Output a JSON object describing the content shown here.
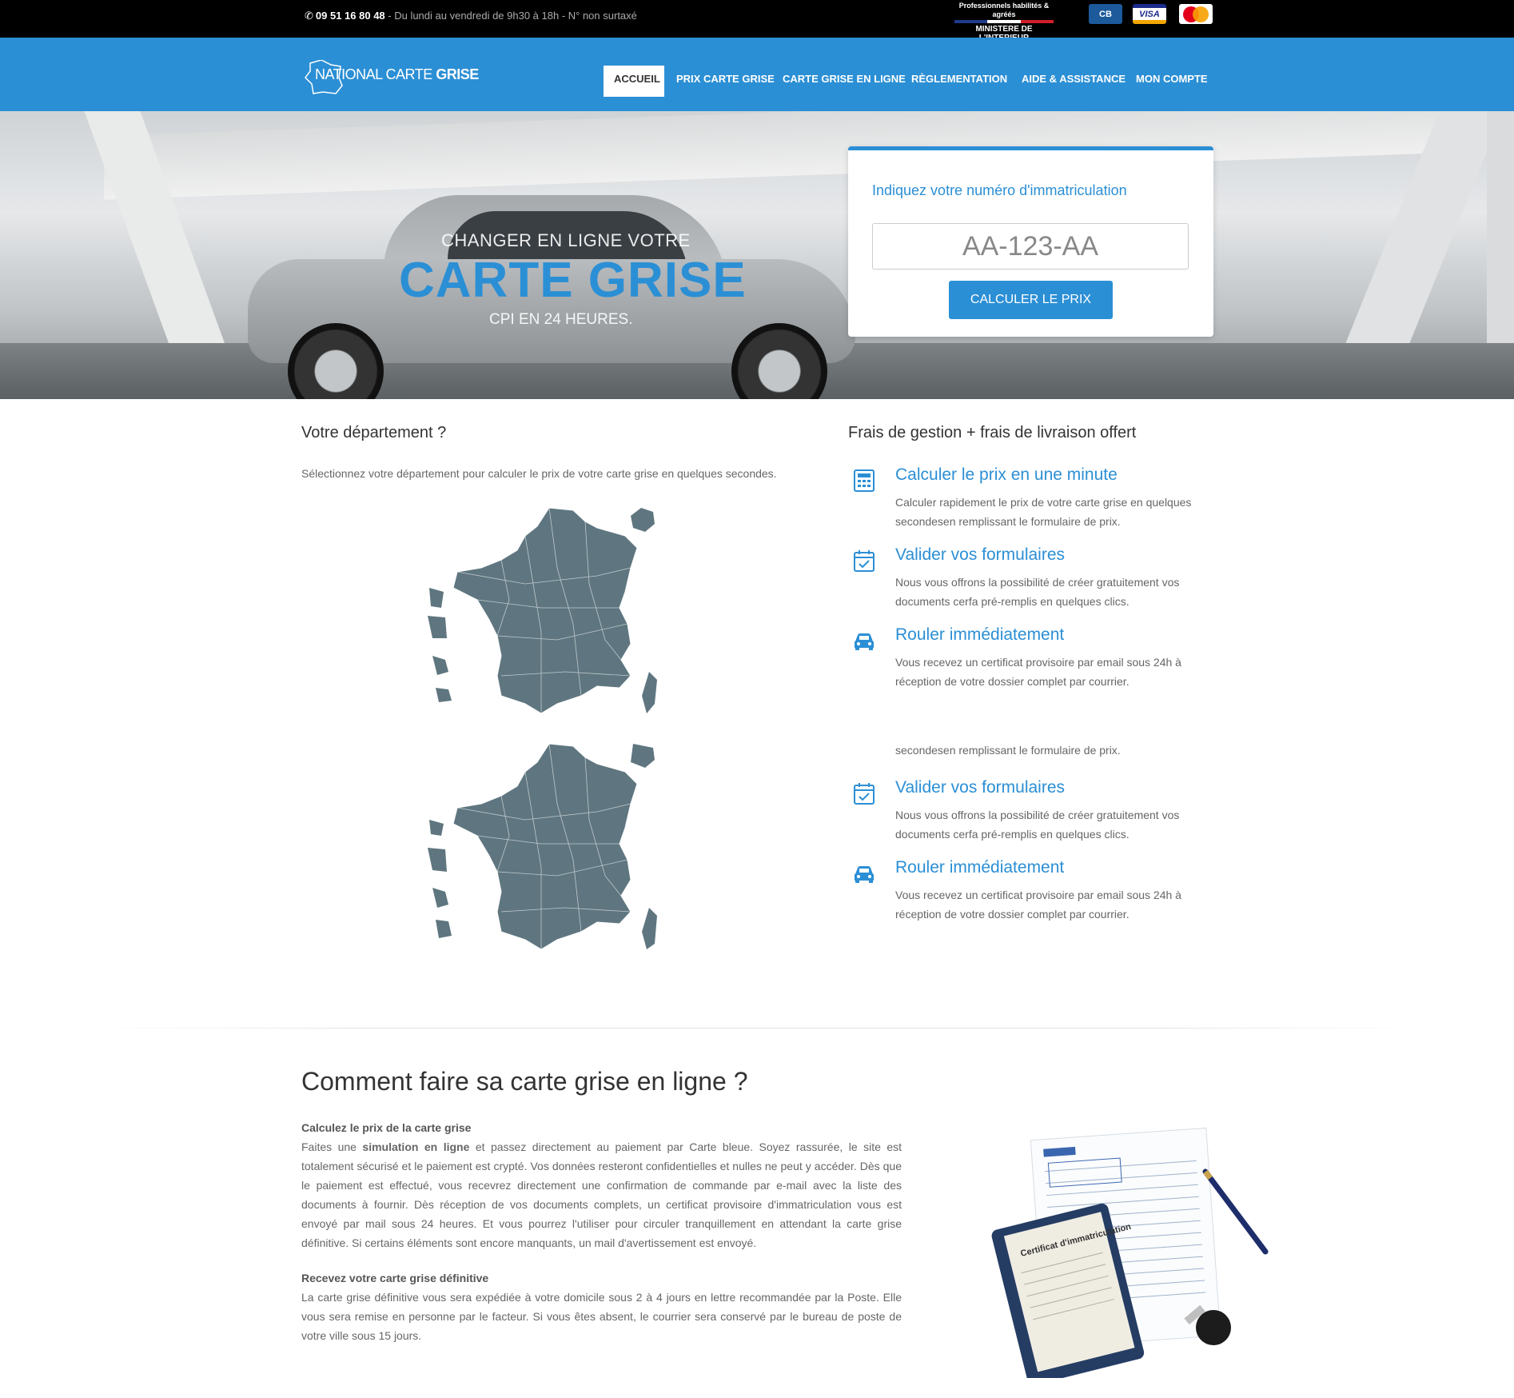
{
  "topbar": {
    "phone": "09 51 16 80 48",
    "hours": " - Du lundi au vendredi de 9h30 à 18h - N° non surtaxé",
    "ministere_line1": "Professionnels habilités & agréés",
    "ministere_line2": "MINISTERE DE L'INTERIEUR",
    "card_cb": "CB",
    "card_visa": "VISA"
  },
  "nav": {
    "logo_part1": "NATIONAL CARTE ",
    "logo_part2": "GRISE",
    "items": [
      {
        "label": "ACCUEIL"
      },
      {
        "label": "PRIX CARTE GRISE"
      },
      {
        "label": "CARTE GRISE EN LIGNE"
      },
      {
        "label": "RÈGLEMENTATION"
      },
      {
        "label": "AIDE & ASSISTANCE"
      },
      {
        "label": "MON COMPTE"
      }
    ]
  },
  "hero": {
    "subtitle_top": "CHANGER EN LIGNE VOTRE",
    "title": "CARTE GRISE",
    "subtitle_bottom": "CPI EN 24 HEURES.",
    "form_label": "Indiquez votre numéro d'immatriculation",
    "input_placeholder": "AA-123-AA",
    "button_label": "CALCULER LE PRIX"
  },
  "departement": {
    "heading": "Votre département ?",
    "text": "Sélectionnez votre département pour calculer le prix de votre carte grise en quelques secondes."
  },
  "features": {
    "heading": "Frais de gestion + frais de livraison offert",
    "items": [
      {
        "title": "Calculer le prix en une minute",
        "text": "Calculer rapidement le prix de votre carte grise en quelques secondesen remplissant le formulaire de prix."
      },
      {
        "title": "Valider vos formulaires",
        "text": "Nous vous offrons la possibilité de créer gratuitement vos documents cerfa pré-remplis en quelques clics."
      },
      {
        "title": "Rouler immédiatement",
        "text": "Vous recevez un certificat provisoire par email sous 24h à réception de votre dossier complet par courrier."
      }
    ],
    "orphan_line": "secondesen remplissant le formulaire de prix.",
    "items_repeat": [
      {
        "title": "Valider vos formulaires",
        "text": "Nous vous offrons la possibilité de créer gratuitement vos documents cerfa pré-remplis en quelques clics."
      },
      {
        "title": "Rouler immédiatement",
        "text": "Vous recevez un certificat provisoire par email sous 24h à réception de votre dossier complet par courrier."
      }
    ]
  },
  "howto": {
    "title": "Comment faire sa carte grise en ligne ?",
    "p1_heading": "Calculez le prix de la carte grise",
    "p1_a": "Faites une ",
    "p1_bold": "simulation en ligne",
    "p1_b": " et passez directement au paiement par Carte bleue. Soyez rassurée, le site est totalement sécurisé et le paiement est crypté. Vos données resteront confidentielles et nulles ne peut y accéder. Dès que le paiement est effectué, vous recevrez directement une confirmation de commande par e-mail avec la liste des documents à fournir. Dès réception de vos documents complets, un certificat provisoire d'immatriculation vous est envoyé par mail sous 24 heures. Et vous pourrez l'utiliser pour circuler tranquillement en attendant la carte grise définitive. Si certains éléments sont encore manquants, un mail d'avertissement est envoyé.",
    "p2_heading": "Recevez votre carte grise définitive",
    "p2_text": "La carte grise définitive vous sera expédiée à votre domicile sous 2 à 4 jours en lettre recommandée par la Poste. Elle vous sera remise en personne par le facteur. Si vous êtes absent, le courrier sera conservé par le bureau de poste de votre ville sous 15 jours.",
    "doc_label": "Certificat d'immatriculation"
  },
  "colors": {
    "brand_blue": "#2b8fd5",
    "topbar_bg": "#000000",
    "map_fill": "#5f7680"
  }
}
